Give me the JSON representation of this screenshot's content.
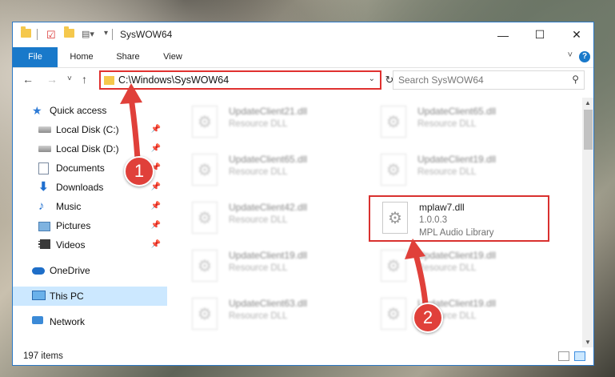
{
  "window": {
    "title": "SysWOW64",
    "controls": {
      "minimize": "—",
      "maximize": "☐",
      "close": "✕"
    }
  },
  "ribbon": {
    "tabs": [
      {
        "label": "File"
      },
      {
        "label": "Home"
      },
      {
        "label": "Share"
      },
      {
        "label": "View"
      }
    ],
    "help": "?"
  },
  "navbar": {
    "back": "←",
    "forward": "→",
    "recent": "˅",
    "up": "↑",
    "address": "C:\\Windows\\SysWOW64",
    "refresh": "↻",
    "search_placeholder": "Search SysWOW64"
  },
  "sidebar": {
    "items": [
      {
        "label": "Quick access",
        "icon": "star-icon",
        "pinned": false
      },
      {
        "label": "Local Disk (C:)",
        "icon": "disk-icon",
        "pinned": true
      },
      {
        "label": "Local Disk (D:)",
        "icon": "disk-icon",
        "pinned": true
      },
      {
        "label": "Documents",
        "icon": "documents-icon",
        "pinned": true
      },
      {
        "label": "Downloads",
        "icon": "downloads-icon",
        "pinned": true
      },
      {
        "label": "Music",
        "icon": "music-icon",
        "pinned": true
      },
      {
        "label": "Pictures",
        "icon": "pictures-icon",
        "pinned": true
      },
      {
        "label": "Videos",
        "icon": "videos-icon",
        "pinned": true
      },
      {
        "label": "OneDrive",
        "icon": "onedrive-icon",
        "pinned": false
      },
      {
        "label": "This PC",
        "icon": "this-pc-icon",
        "pinned": false,
        "selected": true
      },
      {
        "label": "Network",
        "icon": "network-icon",
        "pinned": false
      }
    ]
  },
  "files": {
    "left_column": [
      {
        "name": "UpdateClient21.dll",
        "type": "Resource DLL"
      },
      {
        "name": "UpdateClient65.dll",
        "type": "Resource DLL"
      },
      {
        "name": "UpdateClient42.dll",
        "type": "Resource DLL"
      },
      {
        "name": "UpdateClient19.dll",
        "type": "Resource DLL"
      },
      {
        "name": "UpdateClient63.dll",
        "type": "Resource DLL"
      }
    ],
    "right_column": [
      {
        "name": "UpdateClient65.dll",
        "type": "Resource DLL"
      },
      {
        "name": "UpdateClient19.dll",
        "type": "Resource DLL"
      },
      {
        "name": "mplaw7.dll",
        "version": "1.0.0.3",
        "type": "MPL Audio Library",
        "highlighted": true
      },
      {
        "name": "UpdateClient19.dll",
        "type": "Resource DLL"
      },
      {
        "name": "UpdateClient19.dll",
        "type": "Resource DLL"
      }
    ]
  },
  "status": {
    "item_count": "197 items"
  },
  "annotations": {
    "step1": "1",
    "step2": "2",
    "colors": {
      "highlight": "#d9312f",
      "badge": "#e0403a"
    }
  }
}
